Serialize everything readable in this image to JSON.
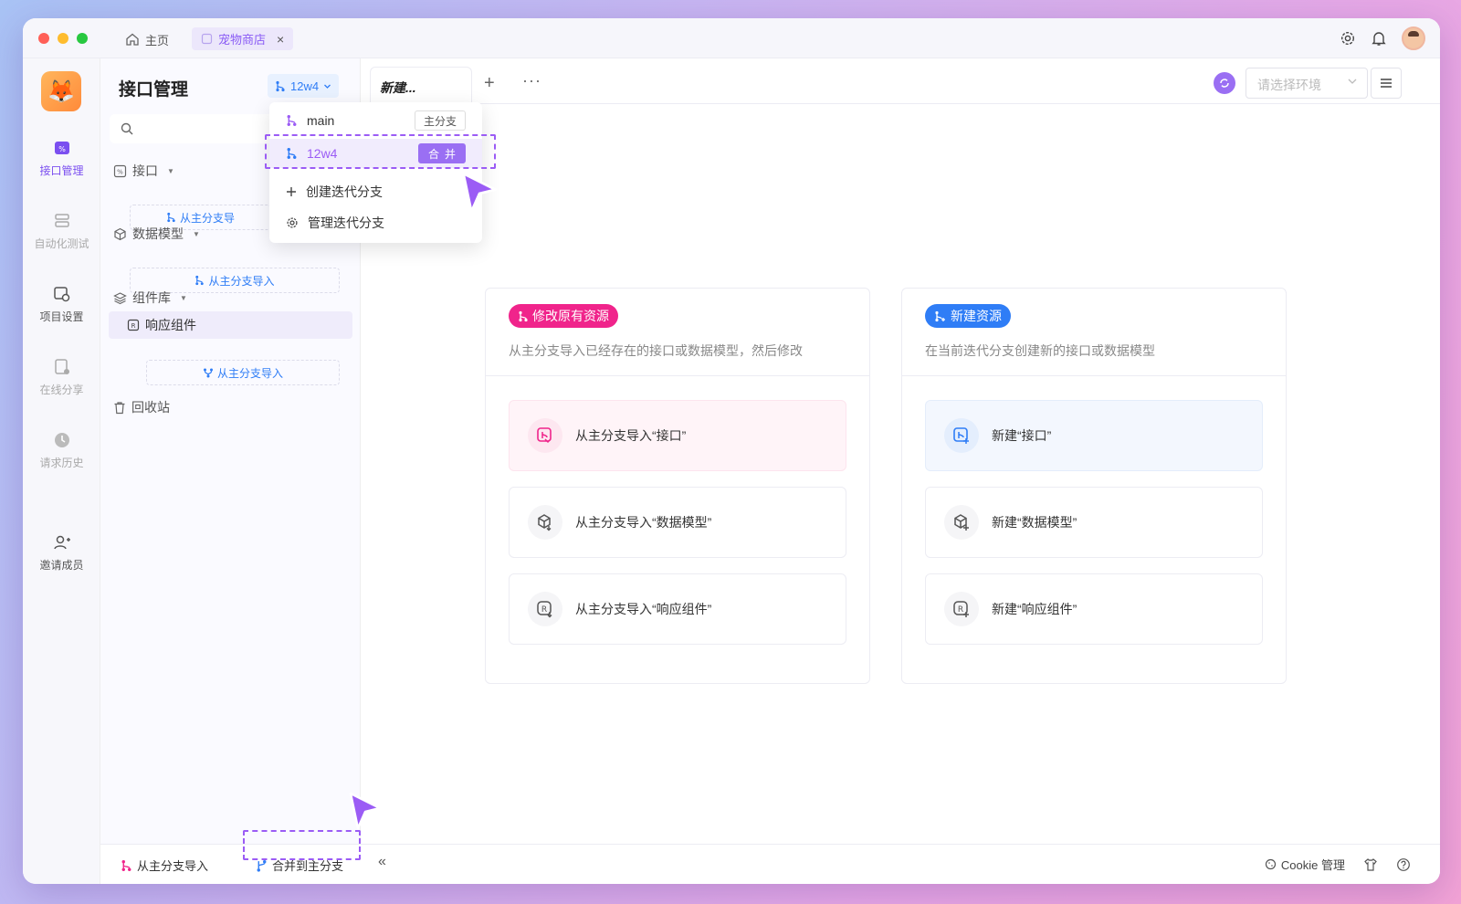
{
  "titlebar": {
    "home_tab": "主页",
    "project_tab": "宠物商店",
    "close_glyph": "×"
  },
  "rail": {
    "items": [
      {
        "label": "接口管理",
        "icon": "api-icon",
        "active": true
      },
      {
        "label": "自动化测试",
        "icon": "automation-icon",
        "active": false
      },
      {
        "label": "项目设置",
        "icon": "project-settings-icon",
        "active": false
      },
      {
        "label": "在线分享",
        "icon": "share-icon",
        "active": false
      },
      {
        "label": "请求历史",
        "icon": "history-icon",
        "active": false
      },
      {
        "label": "邀请成员",
        "icon": "invite-member-icon",
        "active": false
      }
    ]
  },
  "sidebar": {
    "title": "接口管理",
    "branch": "12w4",
    "tree": {
      "api": "接口",
      "data_model": "数据模型",
      "component_lib": "组件库",
      "response_component": "响应组件",
      "recycle_bin": "回收站",
      "import_label": "从主分支导入",
      "import_label_truncated": "从主分支导"
    }
  },
  "dropdown": {
    "branches": [
      {
        "name": "main",
        "badge": "主分支"
      },
      {
        "name": "12w4",
        "badge": "合并"
      }
    ],
    "create_label": "创建迭代分支",
    "manage_label": "管理迭代分支"
  },
  "main": {
    "tab_label": "新建...",
    "plus": "+",
    "more": "···",
    "env_placeholder": "请选择环境",
    "cards": [
      {
        "pill": "修改原有资源",
        "pill_color": "#f0248b",
        "desc": "从主分支导入已经存在的接口或数据模型，然后修改",
        "actions": [
          "从主分支导入“接口”",
          "从主分支导入“数据模型”",
          "从主分支导入“响应组件”"
        ]
      },
      {
        "pill": "新建资源",
        "pill_color": "#2f7df6",
        "desc": "在当前迭代分支创建新的接口或数据模型",
        "actions": [
          "新建“接口”",
          "新建“数据模型”",
          "新建“响应组件”"
        ]
      }
    ]
  },
  "statusbar": {
    "import_btn": "从主分支导入",
    "merge_btn": "合并到主分支",
    "collapse": "«",
    "cookie": "Cookie 管理"
  },
  "colors": {
    "accent": "#9a6ff3",
    "blue": "#2f7df6",
    "pink": "#f0248b"
  }
}
